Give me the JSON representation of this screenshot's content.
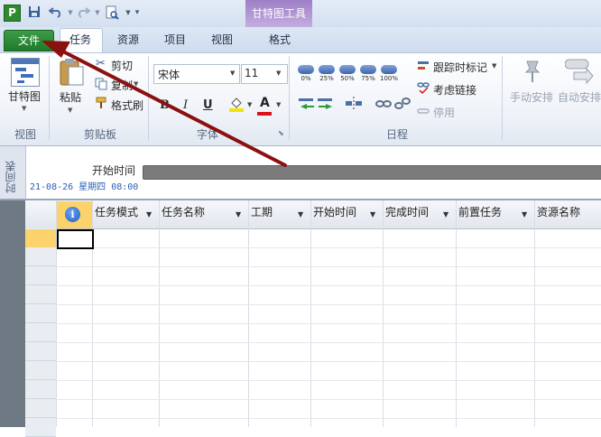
{
  "titlebar": {
    "app_icon": "P",
    "context_tab_title": "甘特图工具"
  },
  "tabs": [
    {
      "label": "文件"
    },
    {
      "label": "任务"
    },
    {
      "label": "资源"
    },
    {
      "label": "项目"
    },
    {
      "label": "视图"
    },
    {
      "label": "格式"
    }
  ],
  "ribbon": {
    "view_group": {
      "label": "视图",
      "gantt_button": "甘特图"
    },
    "clipboard_group": {
      "label": "剪贴板",
      "paste": "粘贴",
      "cut": "剪切",
      "copy": "复制",
      "format_painter": "格式刷"
    },
    "font_group": {
      "label": "字体",
      "font_name": "宋体",
      "font_size": "11",
      "bold": "B",
      "italic": "I",
      "underline": "U",
      "font_color_letter": "A"
    },
    "schedule_group": {
      "label": "日程",
      "percent_buttons": [
        "0%",
        "25%",
        "50%",
        "75%",
        "100%"
      ],
      "track": "跟踪时标记",
      "respect_links": "考虑链接",
      "inactivate": "停用"
    },
    "tasks_group": {
      "manual": "手动安排",
      "auto": "自动安排"
    }
  },
  "timeline": {
    "side_label": "时间表",
    "start_label": "开始时间",
    "start_date": "21-08-26 星期四 08:00"
  },
  "grid": {
    "info_icon": "i",
    "columns": [
      "任务模式",
      "任务名称",
      "工期",
      "开始时间",
      "完成时间",
      "前置任务",
      "资源名称"
    ]
  },
  "colors": {
    "file_tab": "#1f7a2b",
    "context_tab": "#9e7fc6",
    "annotation_arrow": "#8b1010",
    "selected_row": "#fbd36a"
  }
}
